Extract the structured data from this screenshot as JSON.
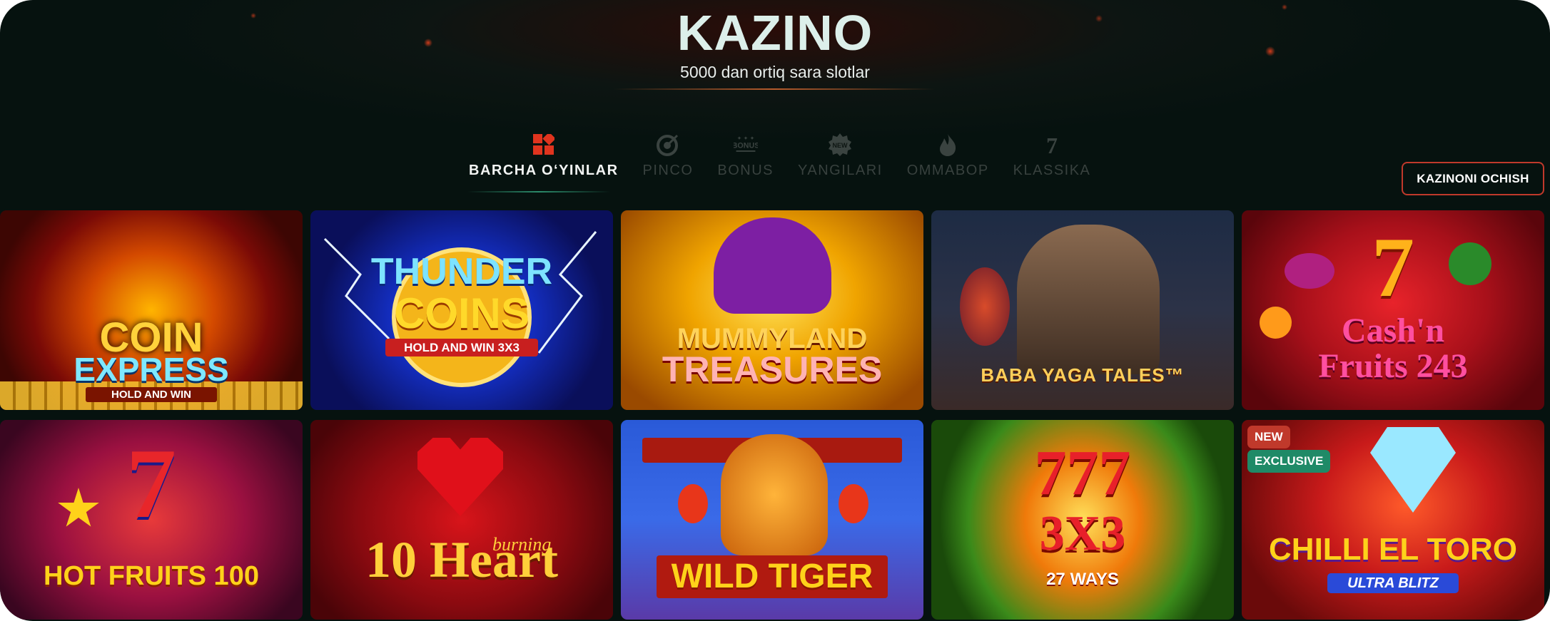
{
  "header": {
    "title": "KAZINO",
    "subtitle": "5000 dan ortiq sara slotlar"
  },
  "tabs": [
    {
      "label": "BARCHA O‘YINLAR",
      "icon": "grid-icon",
      "active": true
    },
    {
      "label": "PINCO",
      "icon": "target-icon",
      "active": false
    },
    {
      "label": "BONUS",
      "icon": "bonus-icon",
      "active": false
    },
    {
      "label": "YANGILARI",
      "icon": "new-badge-icon",
      "active": false
    },
    {
      "label": "OMMABOP",
      "icon": "flame-icon",
      "active": false
    },
    {
      "label": "KLASSIKA",
      "icon": "seven-icon",
      "active": false
    }
  ],
  "open_casino_button": "KAZINONI OCHISH",
  "icon_texts": {
    "bonus": "BONUS",
    "new": "NEW",
    "seven": "7"
  },
  "games": [
    {
      "title_line1": "COIN",
      "title_line2": "EXPRESS",
      "tagline": "HOLD AND WIN"
    },
    {
      "title_line1": "THUNDER",
      "title_line2": "COINS",
      "tagline": "HOLD AND WIN 3X3"
    },
    {
      "title_line1": "MUMMYLAND",
      "title_line2": "TREASURES"
    },
    {
      "title_line1": "BABA YAGA TALES™"
    },
    {
      "title_line1": "Cash'n",
      "title_line2": "Fruits 243",
      "decor": "7"
    },
    {
      "title_line1": "HOT FRUITS 100",
      "decor": "7"
    },
    {
      "title_line1": "10 Heart",
      "tagline": "burning"
    },
    {
      "title_line1": "WILD TIGER"
    },
    {
      "title_line1": "777",
      "title_line2": "3X3",
      "tagline": "27 WAYS"
    },
    {
      "title_line1": "CHILLI EL TORO",
      "tagline": "ULTRA BLITZ",
      "badges": [
        "NEW",
        "EXCLUSIVE"
      ]
    }
  ],
  "colors": {
    "accent_red": "#e0341e",
    "tab_inactive": "#38413e",
    "badge_new": "#c0392b",
    "badge_exclusive": "#1f8a67"
  }
}
